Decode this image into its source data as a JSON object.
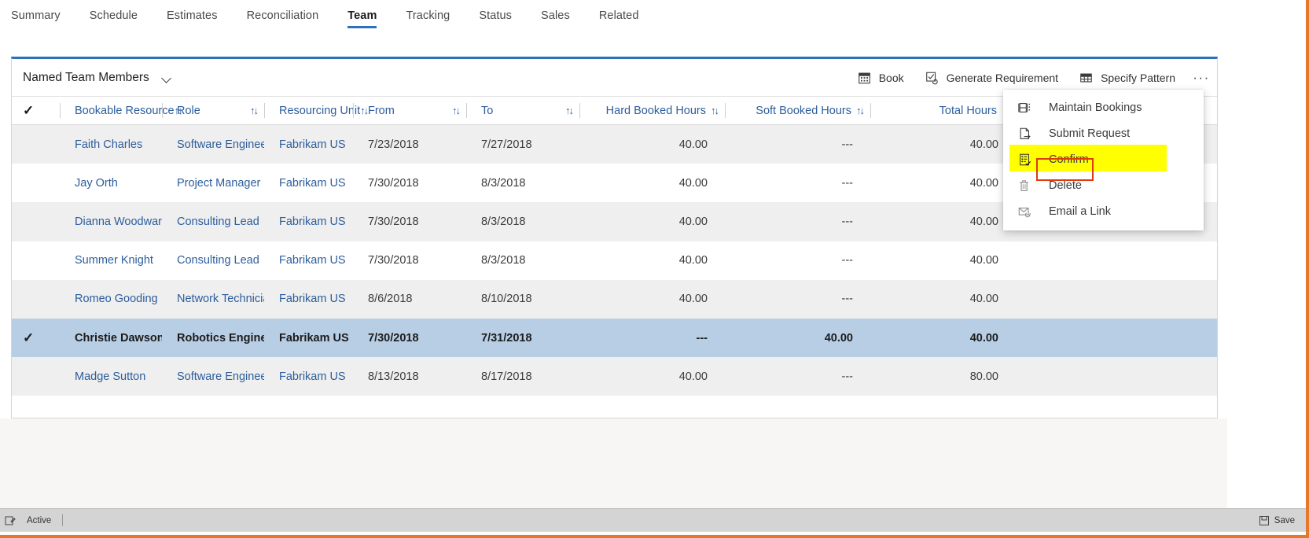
{
  "nav": {
    "tabs": [
      {
        "label": "Summary",
        "active": false
      },
      {
        "label": "Schedule",
        "active": false
      },
      {
        "label": "Estimates",
        "active": false
      },
      {
        "label": "Reconciliation",
        "active": false
      },
      {
        "label": "Team",
        "active": true
      },
      {
        "label": "Tracking",
        "active": false
      },
      {
        "label": "Status",
        "active": false
      },
      {
        "label": "Sales",
        "active": false
      },
      {
        "label": "Related",
        "active": false
      }
    ]
  },
  "grid": {
    "view_title": "Named Team Members",
    "commands": [
      {
        "label": "Book",
        "icon": "calendar-icon"
      },
      {
        "label": "Generate Requirement",
        "icon": "checkbox-refresh-icon"
      },
      {
        "label": "Specify Pattern",
        "icon": "table-grid-icon"
      }
    ],
    "overflow_label": "···",
    "columns": [
      {
        "label": "",
        "key": "check",
        "sortable": false
      },
      {
        "label": "Bookable Resource",
        "key": "resource",
        "sortable": true
      },
      {
        "label": "Role",
        "key": "role",
        "sortable": true
      },
      {
        "label": "Resourcing Unit",
        "key": "unit",
        "sortable": true
      },
      {
        "label": "From",
        "key": "from",
        "sortable": true
      },
      {
        "label": "To",
        "key": "to",
        "sortable": true
      },
      {
        "label": "Hard Booked Hours",
        "key": "hard",
        "sortable": true
      },
      {
        "label": "Soft Booked Hours",
        "key": "soft",
        "sortable": true
      },
      {
        "label": "Total Hours",
        "key": "total",
        "sortable": true
      }
    ],
    "sort_icon": "↑↓",
    "rows": [
      {
        "selected": false,
        "resource": "Faith Charles",
        "role": "Software Engineer",
        "unit": "Fabrikam US",
        "from": "7/23/2018",
        "to": "7/27/2018",
        "hard": "40.00",
        "soft": "---",
        "total": "40.00"
      },
      {
        "selected": false,
        "resource": "Jay Orth",
        "role": "Project Manager",
        "unit": "Fabrikam US",
        "from": "7/30/2018",
        "to": "8/3/2018",
        "hard": "40.00",
        "soft": "---",
        "total": "40.00"
      },
      {
        "selected": false,
        "resource": "Dianna Woodward",
        "role": "Consulting Lead",
        "unit": "Fabrikam US",
        "from": "7/30/2018",
        "to": "8/3/2018",
        "hard": "40.00",
        "soft": "---",
        "total": "40.00"
      },
      {
        "selected": false,
        "resource": "Summer Knight",
        "role": "Consulting Lead",
        "unit": "Fabrikam US",
        "from": "7/30/2018",
        "to": "8/3/2018",
        "hard": "40.00",
        "soft": "---",
        "total": "40.00"
      },
      {
        "selected": false,
        "resource": "Romeo Gooding",
        "role": "Network Technician",
        "unit": "Fabrikam US",
        "from": "8/6/2018",
        "to": "8/10/2018",
        "hard": "40.00",
        "soft": "---",
        "total": "40.00"
      },
      {
        "selected": true,
        "resource": "Christie Dawson",
        "role": "Robotics Engineer",
        "unit": "Fabrikam US",
        "from": "7/30/2018",
        "to": "7/31/2018",
        "hard": "---",
        "soft": "40.00",
        "total": "40.00"
      },
      {
        "selected": false,
        "resource": "Madge Sutton",
        "role": "Software Engineer",
        "unit": "Fabrikam US",
        "from": "8/13/2018",
        "to": "8/17/2018",
        "hard": "40.00",
        "soft": "---",
        "total": "80.00"
      }
    ],
    "selected_checkmark": "✓",
    "header_checkmark": "✓"
  },
  "context_menu": {
    "items": [
      {
        "label": "Maintain Bookings",
        "icon": "bookings-icon",
        "highlighted": false
      },
      {
        "label": "Submit Request",
        "icon": "submit-icon",
        "highlighted": false
      },
      {
        "label": "Confirm",
        "icon": "confirm-icon",
        "highlighted": true
      },
      {
        "label": "Delete",
        "icon": "trash-icon",
        "highlighted": false
      },
      {
        "label": "Email a Link",
        "icon": "email-icon",
        "highlighted": false
      }
    ],
    "highlight_color": "#ffff00",
    "annotation_color": "#e03a10"
  },
  "status_bar": {
    "state_label": "Active",
    "save_label": "Save",
    "left_icon": "edit-form-icon",
    "save_icon": "save-disk-icon"
  },
  "theme": {
    "accent": "#2b72b8",
    "link": "#2c5d9c",
    "selected_row": "#b8cee5",
    "alt_row": "#efefef",
    "window_border": "#e8772e"
  }
}
